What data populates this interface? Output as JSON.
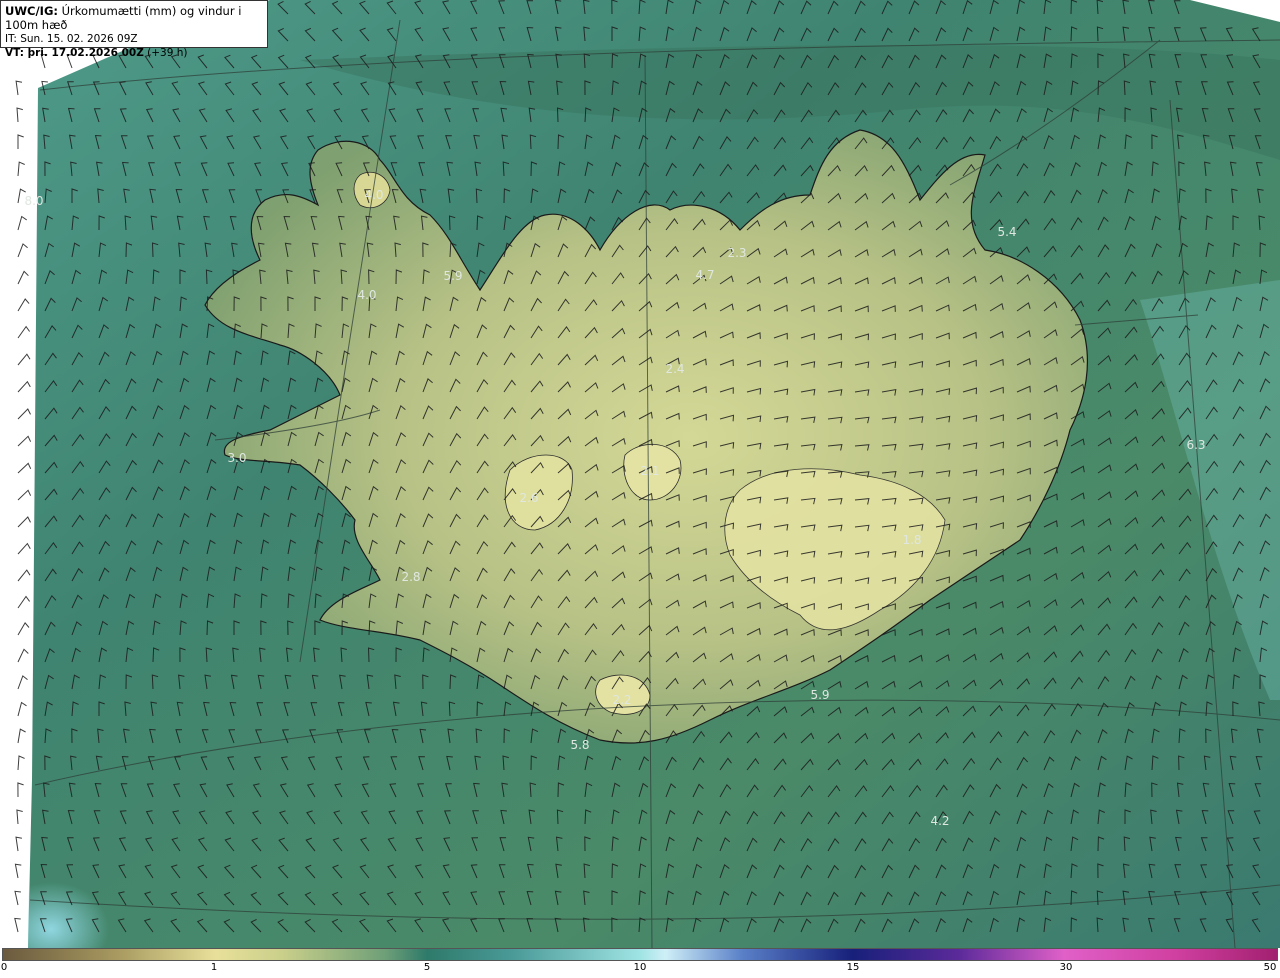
{
  "header": {
    "title_bold": "UWC/IG:",
    "title_text": "Úrkomumætti (mm) og vindur i 100m hæð",
    "it_line": "IT: Sun. 15. 02. 2026 09Z",
    "vt_bold": "VT: þri. 17.02.2026 00Z",
    "vt_text": "(+39 h)"
  },
  "value_labels": [
    "8.0",
    "4.0",
    "4.0",
    "5.9",
    "4.7",
    "2.3",
    "5.4",
    "2.4",
    "6.3",
    "3.0",
    "2.6",
    "2.1",
    "2.8",
    "1.8",
    "2.2",
    "5.9",
    "5.8",
    "4.2"
  ],
  "colorbar": {
    "ticks": [
      "0",
      "1",
      "5",
      "10",
      "15",
      "30",
      "50"
    ]
  },
  "colors": {
    "sea_dark": "#2e6e5c",
    "sea_mid": "#4a8a72",
    "land_mid": "#8fac7a",
    "land_light": "#d6da98",
    "coast": "#1a1a1a"
  }
}
